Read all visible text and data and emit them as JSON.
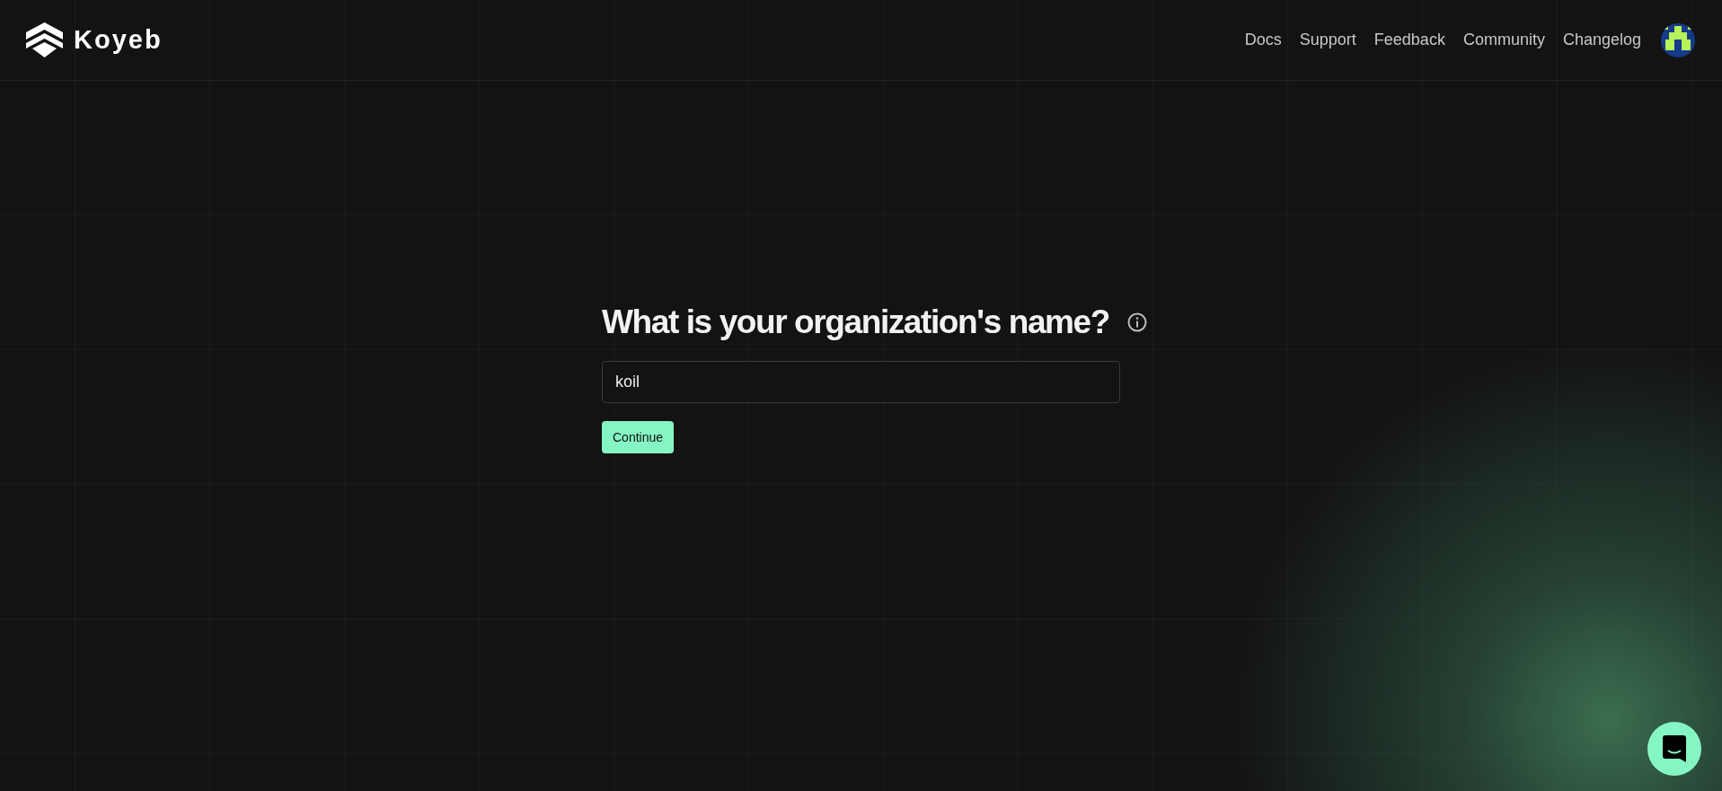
{
  "header": {
    "brand": "Koyeb",
    "nav": [
      "Docs",
      "Support",
      "Feedback",
      "Community",
      "Changelog"
    ]
  },
  "form": {
    "heading": "What is your organization's name?",
    "name_field": {
      "value": "koil"
    },
    "button": "Continue"
  }
}
